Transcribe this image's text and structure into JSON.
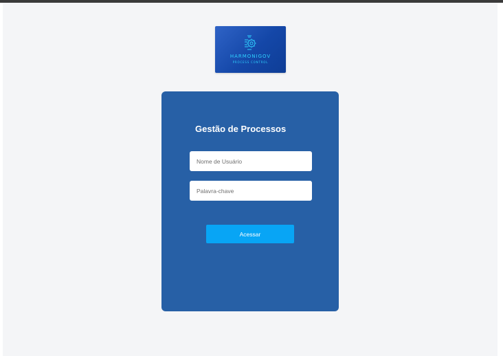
{
  "logo": {
    "name": "HARMONIGOV",
    "tagline": "PROCESS CONTROL",
    "icon": "gear-circuit-icon"
  },
  "login": {
    "title": "Gestão de Processos",
    "username_placeholder": "Nome de Usuário",
    "password_placeholder": "Palavra-chave",
    "submit_label": "Acessar"
  },
  "colors": {
    "page_background": "#f4f5f7",
    "card_background": "#2760a6",
    "button_background": "#08a5f5",
    "logo_accent": "#2fd2ff"
  }
}
